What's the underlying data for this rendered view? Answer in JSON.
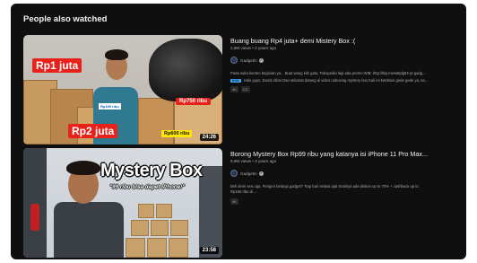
{
  "section": {
    "title": "People also watched"
  },
  "videos": [
    {
      "title": "Buang buang Rp4 juta+ demi Mistery Box :(",
      "meta": "2,8M views • 2 years ago",
      "channel": "Gadgetin",
      "description": "Pada suka konten beginian ya... Buat wong kilo gatu, Tokopedia lagi ada promo WIB: http://tkp.me/w8plg94-yt-gadg...",
      "chapter_ts": "0:00",
      "chapter_text": "Halo guys, David disini Dan selamat datang di video unboxing mystery box Kali ini ketahuis gede gede ya, sa...",
      "badges": [
        "4K",
        "CC"
      ],
      "duration": "24:26",
      "thumb_labels": {
        "top_left": "Rp1 juta",
        "bottom_left": "Rp2 juta",
        "right_mid": "Rp750 ribu",
        "right_bottom": "Rp600 ribu",
        "small": "Rp150 ribu"
      }
    },
    {
      "title": "Borong Mystery Box Rp99 ribu yang katanya isi iPhone 11 Pro Max...",
      "meta": "9,9M views • 3 years ago",
      "channel": "Gadgetin",
      "description": "Beli demi seru aja. Pengen belanja gadget? Tiap hari selasa ajal Soalnya ada diskon up to 70% + cashback up to",
      "description2": "Rp150 ribu di ...",
      "badges": [
        "4K"
      ],
      "duration": "23:58",
      "thumb_labels": {
        "title": "Mystery Box",
        "subtitle": "\"99 ribu bisa dapet iPhone!\""
      }
    }
  ],
  "colors": {
    "background": "#0f0f0f",
    "text_primary": "#f1f1f1",
    "text_secondary": "#aaaaaa",
    "chapter_accent": "#3ea6ff",
    "price_red": "#e8221b",
    "price_yellow": "#ffe600"
  }
}
